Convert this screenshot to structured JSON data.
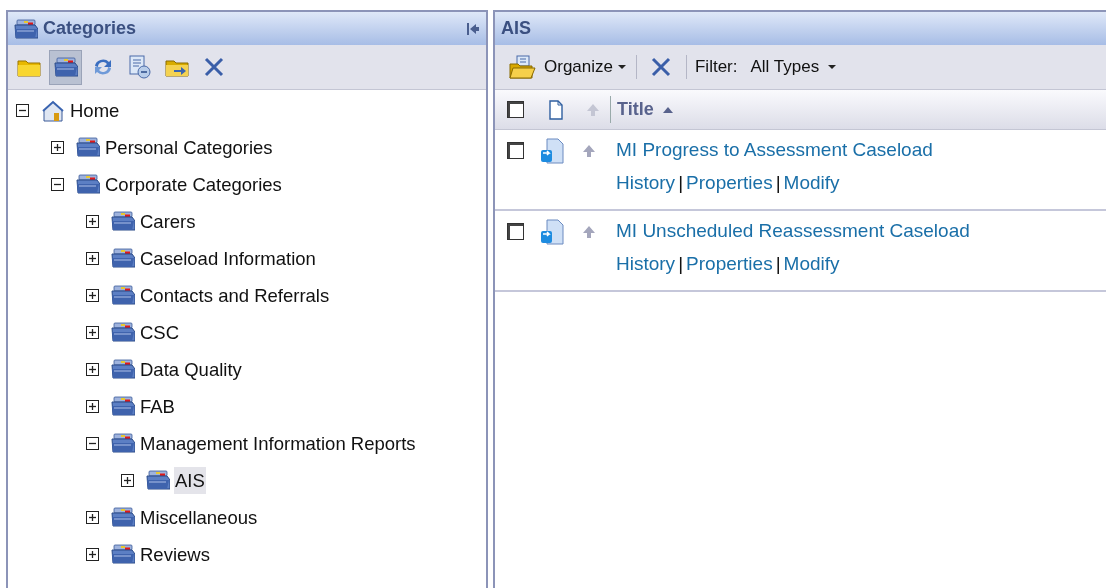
{
  "categories_panel": {
    "title": "Categories",
    "toolbar": [
      {
        "kind": "folder",
        "pressed": false
      },
      {
        "kind": "categories",
        "pressed": true
      },
      {
        "kind": "refresh",
        "pressed": false
      },
      {
        "kind": "properties",
        "pressed": false
      },
      {
        "kind": "move",
        "pressed": false
      },
      {
        "kind": "delete",
        "pressed": false
      }
    ],
    "tree": [
      {
        "label": "Home",
        "kind": "home",
        "expanded": true,
        "selected": false,
        "children": [
          {
            "label": "Personal Categories",
            "kind": "category",
            "expanded": false,
            "selected": false
          },
          {
            "label": "Corporate Categories",
            "kind": "category",
            "expanded": true,
            "selected": false,
            "children": [
              {
                "label": "Carers",
                "kind": "category",
                "expanded": false,
                "selected": false
              },
              {
                "label": "Caseload Information",
                "kind": "category",
                "expanded": false,
                "selected": false
              },
              {
                "label": "Contacts and Referrals",
                "kind": "category",
                "expanded": false,
                "selected": false
              },
              {
                "label": "CSC",
                "kind": "category",
                "expanded": false,
                "selected": false
              },
              {
                "label": "Data Quality",
                "kind": "category",
                "expanded": false,
                "selected": false
              },
              {
                "label": "FAB",
                "kind": "category",
                "expanded": false,
                "selected": false
              },
              {
                "label": "Management Information Reports",
                "kind": "category",
                "expanded": true,
                "selected": false,
                "children": [
                  {
                    "label": "AIS",
                    "kind": "category",
                    "expanded": false,
                    "selected": true
                  }
                ]
              },
              {
                "label": "Miscellaneous",
                "kind": "category",
                "expanded": false,
                "selected": false
              },
              {
                "label": "Reviews",
                "kind": "category",
                "expanded": false,
                "selected": false
              }
            ]
          }
        ]
      }
    ]
  },
  "content_panel": {
    "title": "AIS",
    "toolbar": {
      "organize": "Organize",
      "filter_label": "Filter:",
      "filter_value": "All Types"
    },
    "header": {
      "select_all_checked": false,
      "title": "Title",
      "sort_ascending": true
    },
    "rows": [
      {
        "title": "MI Progress to Assessment Caseload",
        "checked": false,
        "actions": [
          {
            "kind": "link",
            "text": "History"
          },
          {
            "kind": "separator",
            "text": "|"
          },
          {
            "kind": "link",
            "text": "Properties"
          },
          {
            "kind": "separator",
            "text": "|"
          },
          {
            "kind": "link",
            "text": "Modify"
          }
        ]
      },
      {
        "title": "MI Unscheduled Reassessment Caseload",
        "checked": false,
        "actions": [
          {
            "kind": "link",
            "text": "History"
          },
          {
            "kind": "separator",
            "text": "|"
          },
          {
            "kind": "link",
            "text": "Properties"
          },
          {
            "kind": "separator",
            "text": "|"
          },
          {
            "kind": "link",
            "text": "Modify"
          }
        ]
      }
    ]
  }
}
